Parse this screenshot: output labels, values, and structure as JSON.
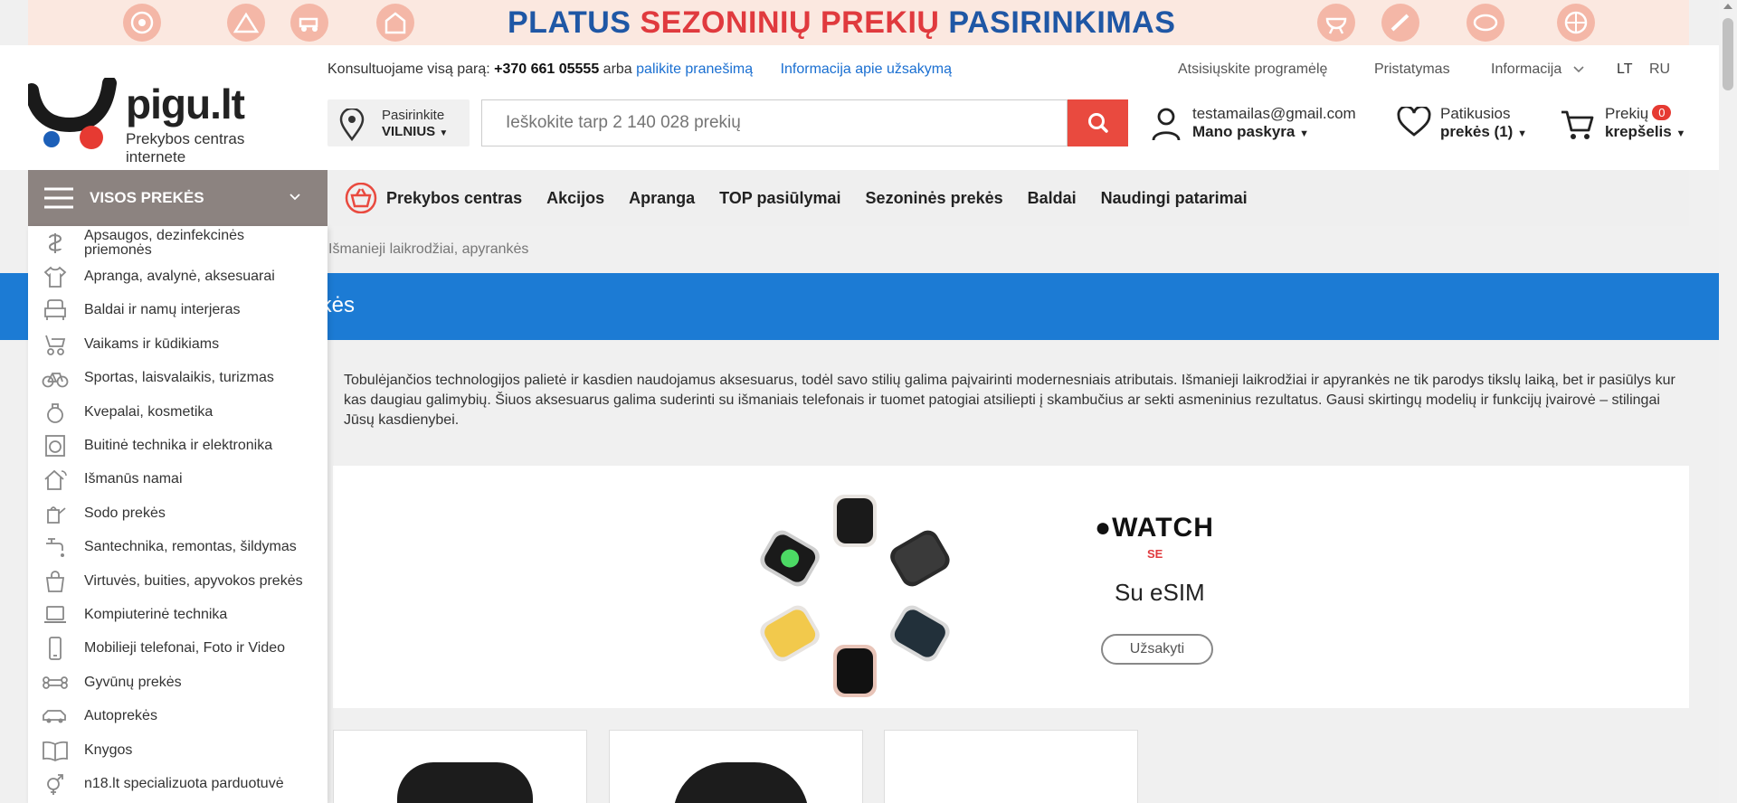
{
  "promo": {
    "title_part1": "PLATUS ",
    "title_part2": "SEZONINIŲ PREKIŲ",
    "title_part3": " PASIRINKIMAS",
    "icons": [
      "wheel-icon",
      "tent-icon",
      "lawn-mower-icon",
      "playhouse-icon",
      "grill-icon",
      "chainsaw-icon",
      "pool-icon",
      "ball-icon"
    ]
  },
  "header": {
    "logo_text": "pigu.lt",
    "logo_tagline": "Prekybos centras internete",
    "consult_prefix": "Konsultuojame visą parą: ",
    "phone": "+370 661 05555",
    "consult_mid": " arba ",
    "leave_message": "palikite pranešimą",
    "order_info": "Informacija apie užsakymą",
    "download_app": "Atsisiųskite programėlę",
    "delivery": "Pristatymas",
    "information": "Informacija",
    "lang_lt": "LT",
    "lang_ru": "RU",
    "location_label": "Pasirinkite",
    "location_city": "VILNIUS",
    "search_placeholder": "Ieškokite tarp 2 140 028 prekių",
    "account_email": "testamailas@gmail.com",
    "account_label": "Mano paskyra",
    "favorites_label": "Patikusios",
    "favorites_count": "prekės (1)",
    "cart_label": "Prekių",
    "cart_count": "0",
    "cart_sub": "krepšelis"
  },
  "nav": {
    "all_products": "VISOS PREKĖS",
    "links": [
      "Prekybos centras",
      "Akcijos",
      "Apranga",
      "TOP pasiūlymai",
      "Sezoninės prekės",
      "Baldai",
      "Naudingi patarimai"
    ]
  },
  "breadcrumb": "Išmanieji laikrodžiai, apyrankės",
  "category_title_visible": "kės",
  "description": "Tobulėjančios technologijos palietė ir kasdien naudojamus aksesuarus, todėl savo stilių galima paįvairinti modernesniais atributais. Išmanieji laikrodžiai ir apyrankės ne tik parodys tikslų laiką, bet ir pasiūlys kur kas daugiau galimybių. Šiuos aksesuarus galima suderinti su išmaniais telefonais ir tuomet patogiai atsiliepti į skambučius ar sekti asmeninius rezultatus. Gausi skirtingų modelių ir funkcijų įvairovė – stilingai Jūsų kasdienybei.",
  "hero": {
    "brand": "WATCH",
    "model": "SE",
    "tagline": "Su eSIM",
    "button": "Užsakyti"
  },
  "categories": [
    {
      "label": "Apsaugos, dezinfekcinės priemonės",
      "icon": "pharmacy-icon"
    },
    {
      "label": "Apranga, avalynė, aksesuarai",
      "icon": "tshirt-icon"
    },
    {
      "label": "Baldai ir namų interjeras",
      "icon": "armchair-icon"
    },
    {
      "label": "Vaikams ir kūdikiams",
      "icon": "stroller-icon"
    },
    {
      "label": "Sportas, laisvalaikis, turizmas",
      "icon": "bicycle-icon"
    },
    {
      "label": "Kvepalai, kosmetika",
      "icon": "perfume-icon"
    },
    {
      "label": "Buitinė technika ir elektronika",
      "icon": "washing-machine-icon"
    },
    {
      "label": "Išmanūs namai",
      "icon": "smart-home-icon"
    },
    {
      "label": "Sodo prekės",
      "icon": "watering-can-icon"
    },
    {
      "label": "Santechnika, remontas, šildymas",
      "icon": "faucet-icon"
    },
    {
      "label": "Virtuvės, buities, apyvokos prekės",
      "icon": "bag-icon"
    },
    {
      "label": "Kompiuterinė technika",
      "icon": "laptop-icon"
    },
    {
      "label": "Mobilieji telefonai, Foto ir Video",
      "icon": "phone-icon"
    },
    {
      "label": "Gyvūnų prekės",
      "icon": "bone-icon"
    },
    {
      "label": "Autoprekės",
      "icon": "car-icon"
    },
    {
      "label": "Knygos",
      "icon": "book-icon"
    },
    {
      "label": "n18.lt specializuota parduotuvė",
      "icon": "gender-icon"
    }
  ],
  "colors": {
    "accent_blue": "#1c7bd4",
    "search_red": "#e94a3f",
    "menu_header": "#8c8380",
    "promo_blue": "#1f57a5",
    "promo_red": "#e03a3e"
  }
}
